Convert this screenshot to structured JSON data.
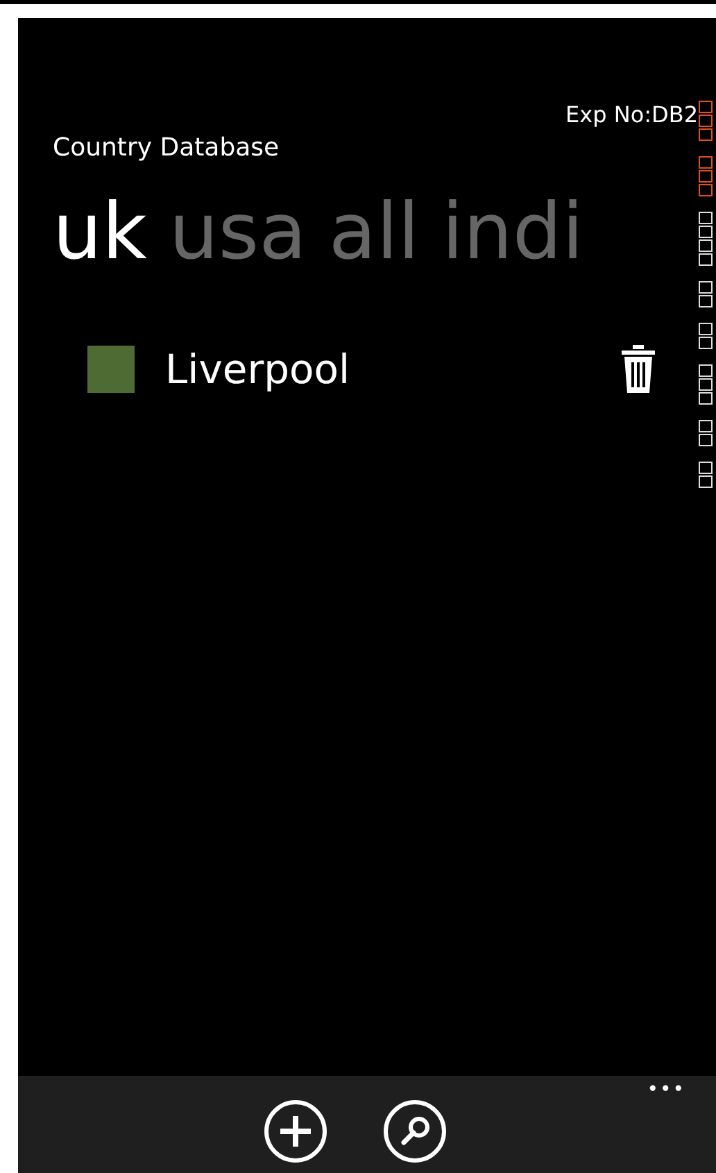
{
  "app_title": "Country Database",
  "experiment": "Exp No:DB2",
  "pivots": [
    {
      "label": "uk",
      "selected": true
    },
    {
      "label": "usa",
      "selected": false
    },
    {
      "label": "all",
      "selected": false
    },
    {
      "label": "indi",
      "selected": false
    }
  ],
  "items": [
    {
      "name": "Liverpool",
      "color": "#4f6b34"
    }
  ],
  "app_bar": {
    "buttons": [
      {
        "kind": "add"
      },
      {
        "kind": "search"
      }
    ],
    "more": "•••"
  }
}
